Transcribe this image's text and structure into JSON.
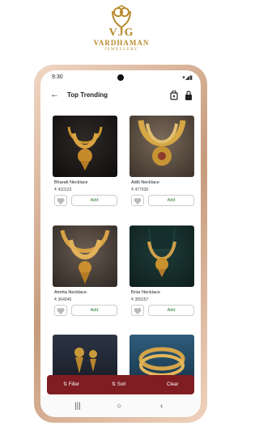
{
  "brand": {
    "letters": "VJG",
    "name": "VARDHAMAN",
    "subtitle": "JEWELLERY",
    "color": "#b88a2c"
  },
  "status_bar": {
    "time": "9:30",
    "icons": "▾◢▮"
  },
  "header": {
    "title": "Top Trending",
    "back_icon": "arrow-left-icon",
    "icon1": "shopping-bag-icon",
    "icon2": "lock-icon"
  },
  "products": [
    {
      "name": "Bharati Necklace",
      "price": "₹ 410123",
      "add_label": "Add"
    },
    {
      "name": "Aditi Necklace",
      "price": "₹ 477930",
      "add_label": "Add"
    },
    {
      "name": "Amrita Necklace",
      "price": "₹ 304945",
      "add_label": "Add"
    },
    {
      "name": "Briar Necklace",
      "price": "₹ 355257",
      "add_label": "Add"
    },
    {
      "name": "",
      "price": "",
      "add_label": ""
    },
    {
      "name": "",
      "price": "",
      "add_label": ""
    }
  ],
  "bottom_bar": {
    "filter_label": "Filter",
    "sort_label": "Sort",
    "clear_label": "Clear",
    "color": "#7f1d22"
  },
  "nav": {
    "recents_icon": "recents-icon",
    "home_icon": "home-icon",
    "back_icon": "back-icon"
  }
}
